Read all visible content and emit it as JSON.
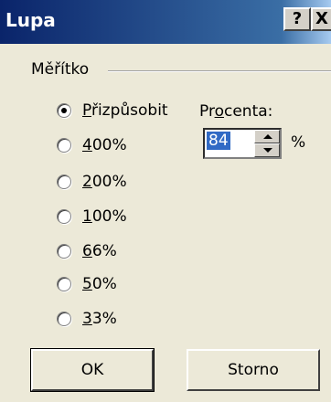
{
  "window": {
    "title": "Lupa",
    "help_button": "?",
    "close_button": "X"
  },
  "group": {
    "label": "Měřítko"
  },
  "radios": {
    "fit": {
      "label_ul": "P",
      "label_rest": "řizpůsobit",
      "checked": true
    },
    "r400": {
      "label_ul": "4",
      "label_rest": "00%",
      "checked": false
    },
    "r200": {
      "label_ul": "2",
      "label_rest": "00%",
      "checked": false
    },
    "r100": {
      "label_ul": "1",
      "label_rest": "00%",
      "checked": false
    },
    "r66": {
      "label_ul": "6",
      "label_rest": "6%",
      "checked": false
    },
    "r50": {
      "label_ul": "5",
      "label_rest": "0%",
      "checked": false
    },
    "r33": {
      "label_ul": "3",
      "label_rest": "3%",
      "checked": false
    }
  },
  "percent": {
    "label_pre": "Pr",
    "label_ul": "o",
    "label_post": "centa:",
    "value": "84",
    "unit": "%"
  },
  "buttons": {
    "ok": "OK",
    "cancel": "Storno"
  }
}
